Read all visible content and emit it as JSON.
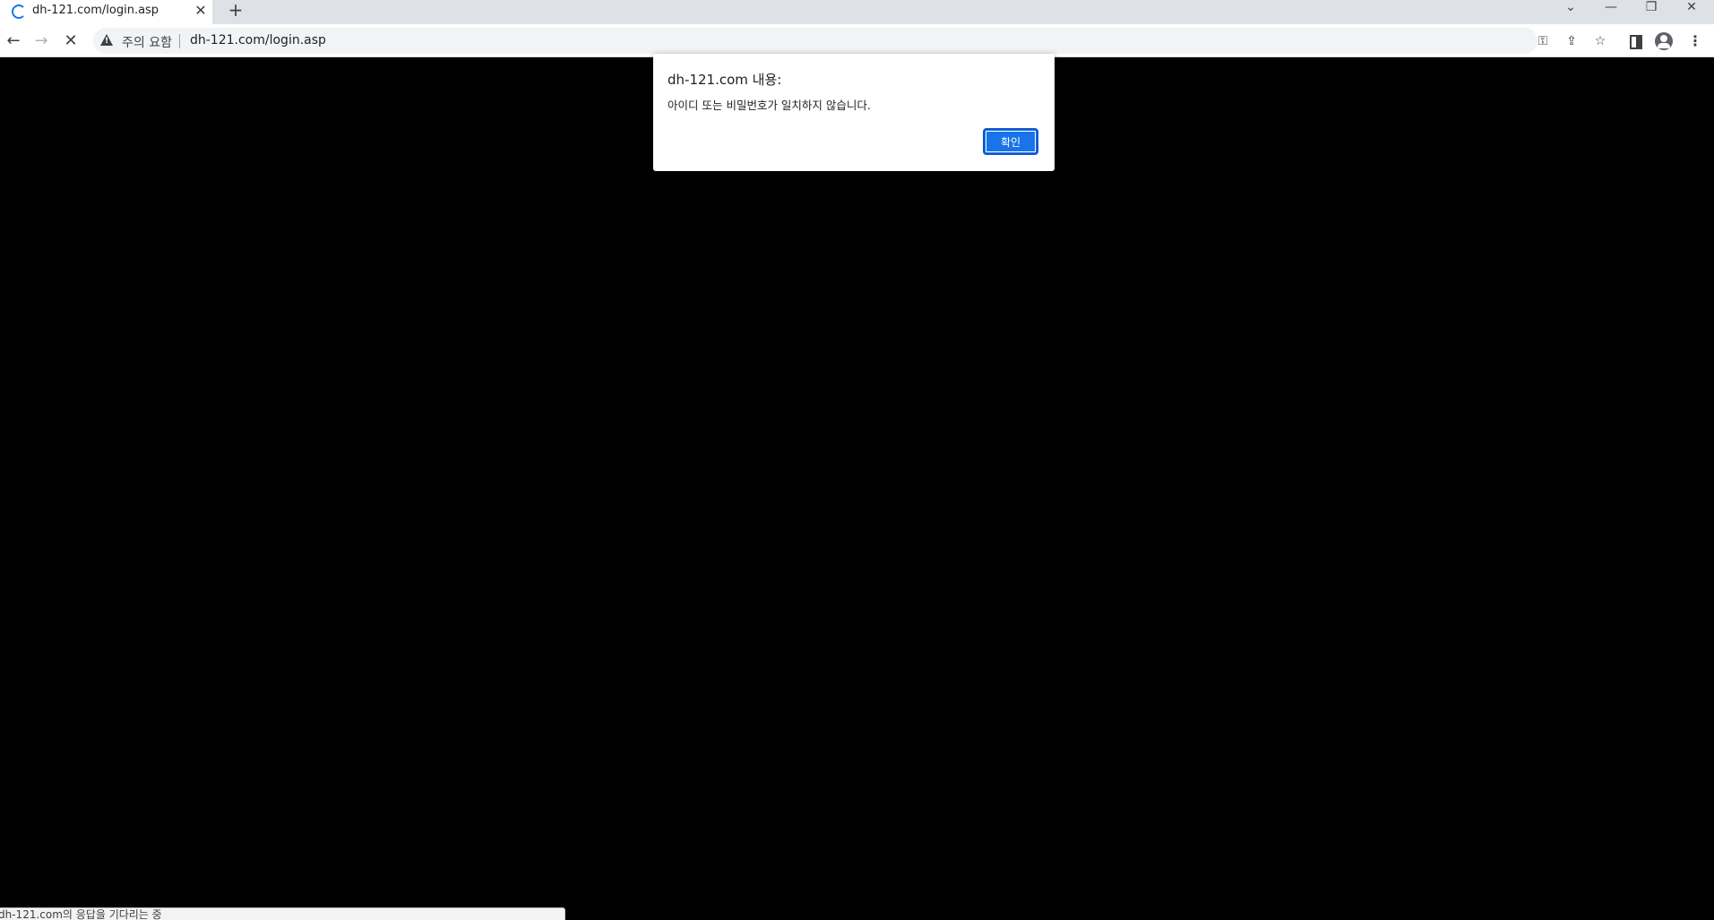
{
  "tab": {
    "title": "dh-121.com/login.asp",
    "close_glyph": "✕",
    "loading_icon": "loading-spinner-icon"
  },
  "new_tab": {
    "glyph": "+"
  },
  "window_controls": {
    "tab_search_glyph": "⌄",
    "minimize_glyph": "—",
    "restore_glyph": "❐",
    "close_glyph": "✕"
  },
  "toolbar": {
    "back_glyph": "←",
    "forward_glyph": "→",
    "stop_glyph": "✕",
    "security_label": "주의 요함",
    "url": "dh-121.com/login.asp",
    "key_glyph": "⚿",
    "share_glyph": "⇪",
    "star_glyph": "☆",
    "menu_glyph": "⋮"
  },
  "dialog": {
    "title": "dh-121.com 내용:",
    "message": "아이디 또는 비밀번호가 일치하지 않습니다.",
    "ok_label": "확인",
    "accent_color": "#1a73e8"
  },
  "status_bar": {
    "text": "dh-121.com의 응답을 기다리는 중"
  }
}
